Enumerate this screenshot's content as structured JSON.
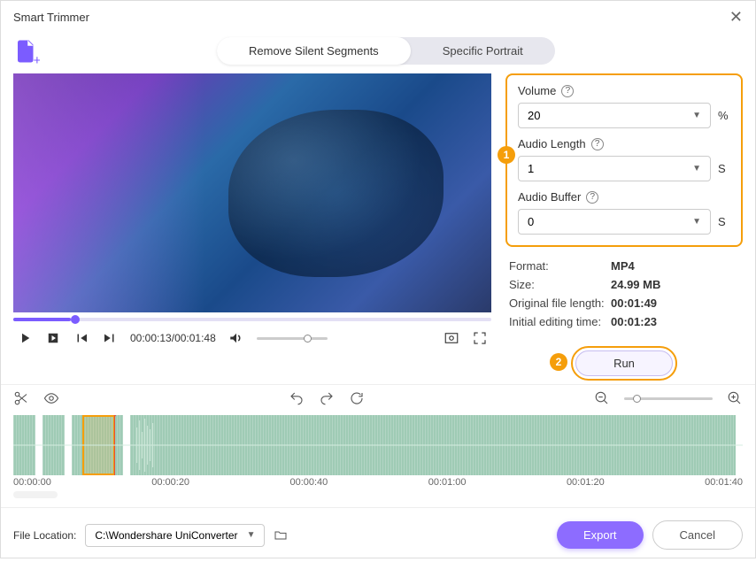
{
  "window": {
    "title": "Smart Trimmer"
  },
  "tabs": {
    "remove_silent": "Remove Silent Segments",
    "specific_portrait": "Specific Portrait"
  },
  "settings": {
    "volume": {
      "label": "Volume",
      "value": "20",
      "unit": "%"
    },
    "audio_length": {
      "label": "Audio Length",
      "value": "1",
      "unit": "S"
    },
    "audio_buffer": {
      "label": "Audio Buffer",
      "value": "0",
      "unit": "S"
    }
  },
  "info": {
    "format_label": "Format:",
    "format_value": "MP4",
    "size_label": "Size:",
    "size_value": "24.99 MB",
    "orig_len_label": "Original file length:",
    "orig_len_value": "00:01:49",
    "init_time_label": "Initial editing time:",
    "init_time_value": "00:01:23"
  },
  "run": {
    "label": "Run"
  },
  "player": {
    "current": "00:00:13",
    "total": "00:01:48"
  },
  "ruler": {
    "t0": "00:00:00",
    "t1": "00:00:20",
    "t2": "00:00:40",
    "t3": "00:01:00",
    "t4": "00:01:20",
    "t5": "00:01:40"
  },
  "footer": {
    "label": "File Location:",
    "path": "C:\\Wondershare UniConverter",
    "export": "Export",
    "cancel": "Cancel"
  },
  "callouts": {
    "one": "1",
    "two": "2"
  }
}
